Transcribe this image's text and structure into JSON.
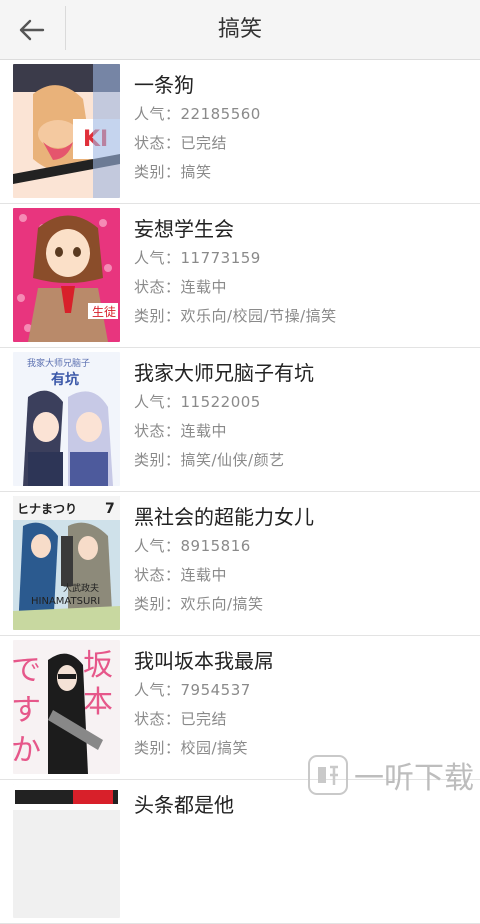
{
  "header": {
    "title": "搞笑",
    "back_icon": "arrow-left-icon"
  },
  "comics": [
    {
      "title": "一条狗",
      "popularity": "人气：22185560",
      "status": "状态：已完结",
      "category": "类别：搞笑",
      "cover_color": "#f3c0b0"
    },
    {
      "title": "妄想学生会",
      "popularity": "人气：11773159",
      "status": "状态：连载中",
      "category": "类别：欢乐向/校园/节操/搞笑",
      "cover_color": "#e8357e"
    },
    {
      "title": "我家大师兄脑子有坑",
      "popularity": "人气：11522005",
      "status": "状态：连载中",
      "category": "类别：搞笑/仙侠/颜艺",
      "cover_color": "#dfe8f7"
    },
    {
      "title": "黑社会的超能力女儿",
      "popularity": "人气：8915816",
      "status": "状态：连载中",
      "category": "类别：欢乐向/搞笑",
      "cover_color": "#6f9fb8"
    },
    {
      "title": "我叫坂本我最屌",
      "popularity": "人气：7954537",
      "status": "状态：已完结",
      "category": "类别：校园/搞笑",
      "cover_color": "#e86c8f"
    },
    {
      "title": "头条都是他",
      "popularity": "",
      "status": "",
      "category": "",
      "cover_color": "#f0f0f0"
    }
  ],
  "watermark": {
    "text": "一听下载"
  }
}
